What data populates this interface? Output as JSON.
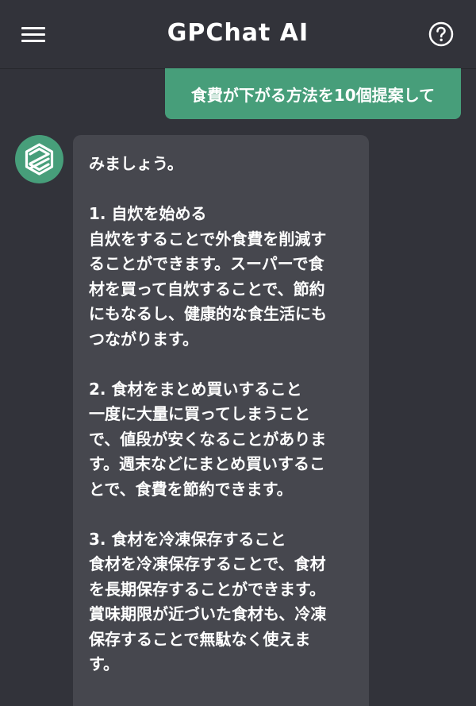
{
  "header": {
    "title": "GPChat AI",
    "menu_icon": "hamburger-menu-icon",
    "help_icon": "help-circle-icon"
  },
  "colors": {
    "background": "#32333a",
    "user_bubble": "#479e7a",
    "bot_bubble": "#46474e",
    "accent": "#479e7a"
  },
  "messages": [
    {
      "role": "user",
      "text": "食費が下がる方法を10個提案して"
    },
    {
      "role": "assistant",
      "avatar_icon": "gpchat-logo-icon",
      "text": "みましょう。\n\n1. 自炊を始める\n自炊をすることで外食費を削減す\nることができます。スーパーで食\n材を買って自炊することで、節約\nにもなるし、健康的な食生活にも\nつながります。\n\n2. 食材をまとめ買いすること\n一度に大量に買ってしまうこと\nで、値段が安くなることがありま\nす。週末などにまとめ買いするこ\nとで、食費を節約できます。\n\n3. 食材を冷凍保存すること\n食材を冷凍保存することで、食材\nを長期保存することができます。\n賞味期限が近づいた食材も、冷凍\n保存することで無駄なく使えま\nす。"
    }
  ]
}
